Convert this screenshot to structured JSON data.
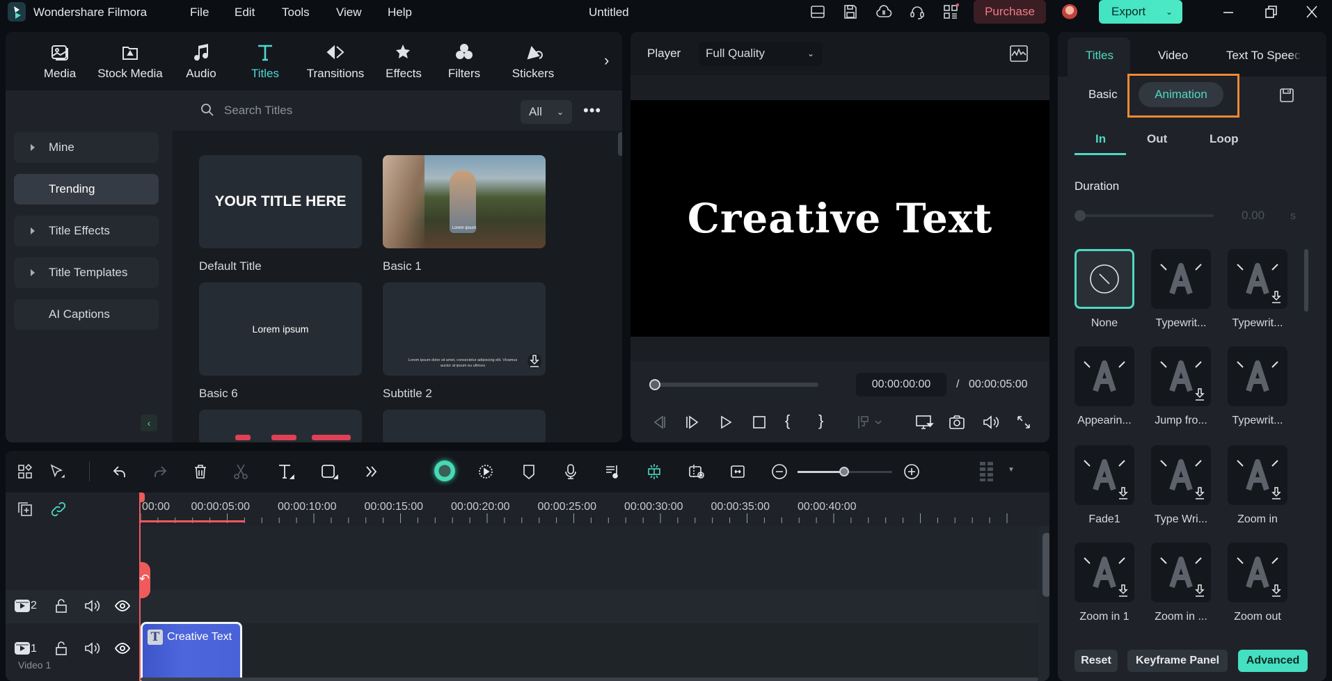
{
  "app": {
    "name": "Wondershare Filmora",
    "menu": [
      "File",
      "Edit",
      "Tools",
      "View",
      "Help"
    ],
    "document_title": "Untitled",
    "purchase_label": "Purchase",
    "export_label": "Export",
    "toolbar_icons": [
      "layout-icon",
      "save-icon",
      "cloud-icon",
      "headset-icon",
      "apps-icon"
    ],
    "window_controls": [
      "minimize-icon",
      "restore-icon",
      "close-icon"
    ]
  },
  "media_tabs": [
    {
      "label": "Media",
      "icon": "media-icon"
    },
    {
      "label": "Stock Media",
      "icon": "stock-media-icon"
    },
    {
      "label": "Audio",
      "icon": "music-icon"
    },
    {
      "label": "Titles",
      "icon": "titles-icon",
      "active": true
    },
    {
      "label": "Transitions",
      "icon": "transitions-icon"
    },
    {
      "label": "Effects",
      "icon": "effects-icon"
    },
    {
      "label": "Filters",
      "icon": "filters-icon"
    },
    {
      "label": "Stickers",
      "icon": "stickers-icon"
    }
  ],
  "sidebar": {
    "items": [
      {
        "label": "Mine",
        "expandable": true
      },
      {
        "label": "Trending",
        "active": true
      },
      {
        "label": "Title Effects",
        "expandable": true
      },
      {
        "label": "Title Templates",
        "expandable": true
      },
      {
        "label": "AI Captions"
      }
    ]
  },
  "titles_browser": {
    "search_placeholder": "Search Titles",
    "filter_value": "All",
    "items": [
      {
        "label": "Default Title",
        "preview_text": "YOUR TITLE HERE"
      },
      {
        "label": "Basic 1",
        "preview_text": "Lorem ipsum"
      },
      {
        "label": "Basic 6",
        "preview_text": "Lorem ipsum"
      },
      {
        "label": "Subtitle 2",
        "preview_text": "Lorem ipsum dolor sit amet, consectetur adipiscing elit. Vivamus auctor at ipsum eu ultrices",
        "downloadable": true
      }
    ]
  },
  "player": {
    "label": "Player",
    "quality": "Full Quality",
    "preview_text": "Creative Text",
    "current_time": "00:00:00:00",
    "separator": "/",
    "total_time": "00:00:05:00",
    "progress": 0
  },
  "properties": {
    "tabs": [
      "Titles",
      "Video",
      "Text To Speech"
    ],
    "active_tab": "Titles",
    "subtabs": [
      "Basic",
      "Animation"
    ],
    "active_subtab": "Animation",
    "anim_tabs": [
      "In",
      "Out",
      "Loop"
    ],
    "active_anim_tab": "In",
    "duration_label": "Duration",
    "duration_value": "0.00",
    "duration_unit": "s",
    "animations": [
      {
        "label": "None",
        "selected": true
      },
      {
        "label": "Typewrit..."
      },
      {
        "label": "Typewrit...",
        "downloadable": true
      },
      {
        "label": "Appearin..."
      },
      {
        "label": "Jump fro...",
        "downloadable": true
      },
      {
        "label": "Typewrit..."
      },
      {
        "label": "Fade1",
        "downloadable": true
      },
      {
        "label": "Type Wri...",
        "downloadable": true
      },
      {
        "label": "Zoom in",
        "downloadable": true
      },
      {
        "label": "Zoom in 1",
        "downloadable": true
      },
      {
        "label": "Zoom in ...",
        "downloadable": true
      },
      {
        "label": "Zoom out",
        "downloadable": true
      }
    ],
    "buttons": {
      "reset": "Reset",
      "keyframe": "Keyframe Panel",
      "advanced": "Advanced"
    }
  },
  "timeline": {
    "ruler": [
      "00:00",
      "00:00:05:00",
      "00:00:10:00",
      "00:00:15:00",
      "00:00:20:00",
      "00:00:25:00",
      "00:00:30:00",
      "00:00:35:00",
      "00:00:40:00"
    ],
    "tracks": [
      {
        "number": "2"
      },
      {
        "number": "1",
        "name": "Video 1"
      }
    ],
    "clip": {
      "label": "Creative Text"
    },
    "zoom_level": 0.6
  },
  "colors": {
    "accent": "#4fd8c2",
    "playhead": "#f05a5a",
    "clip": "#4a62d8",
    "highlight_box": "#f08a36"
  }
}
